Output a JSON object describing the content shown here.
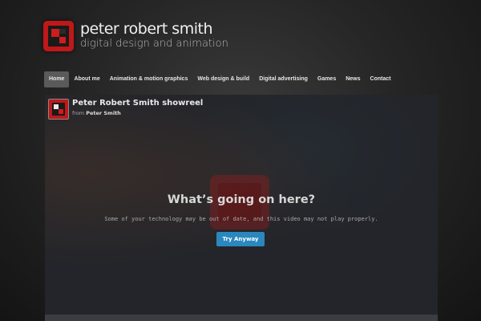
{
  "site": {
    "name": "peter robert smith",
    "tagline": "digital design and animation",
    "logo_icon": "red-pixel-logo-icon",
    "brand_color": "#c01818"
  },
  "nav": {
    "items": [
      {
        "label": "Home",
        "active": true
      },
      {
        "label": "About me",
        "active": false
      },
      {
        "label": "Animation & motion graphics",
        "active": false
      },
      {
        "label": "Web design & build",
        "active": false
      },
      {
        "label": "Digital advertising",
        "active": false
      },
      {
        "label": "Games",
        "active": false
      },
      {
        "label": "News",
        "active": false
      },
      {
        "label": "Contact",
        "active": false
      }
    ]
  },
  "video": {
    "title": "Peter Robert Smith showreel",
    "from_label": "from",
    "author": "Peter Smith",
    "message_title": "What’s going on here?",
    "message_body": "Some of your technology may be out of date, and this video may not play properly.",
    "button_label": "Try Anyway",
    "button_color": "#2a88be"
  }
}
